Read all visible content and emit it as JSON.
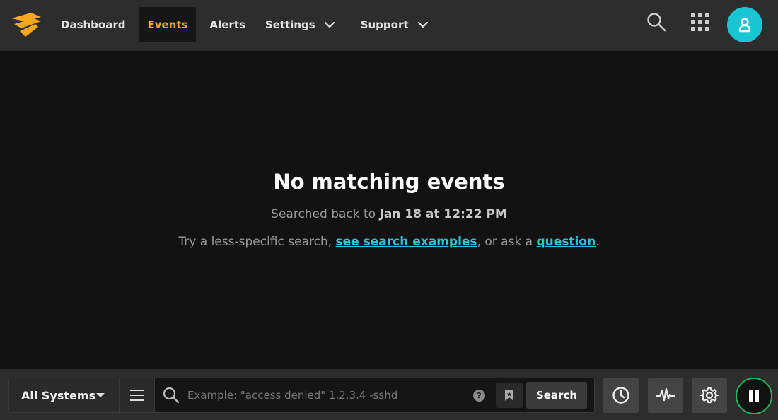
{
  "nav": {
    "items": [
      {
        "label": "Dashboard"
      },
      {
        "label": "Events"
      },
      {
        "label": "Alerts"
      },
      {
        "label": "Settings"
      },
      {
        "label": "Support"
      }
    ],
    "active": "Events"
  },
  "icons": {
    "logo": "papertrail-logo",
    "search": "search-icon",
    "apps": "grid-icon",
    "avatar": "user-icon",
    "menu": "hamburger-icon",
    "help": "question-icon",
    "bookmark": "bookmark-icon",
    "history": "clock-icon",
    "graph": "pulse-icon",
    "settings": "gear-icon",
    "pause": "pause-icon"
  },
  "colors": {
    "accent": "#f5a623",
    "link": "#2ec4d6",
    "avatar": "#17c6d3",
    "live": "#21b25a"
  },
  "empty": {
    "title": "No matching events",
    "searched_prefix": "Searched back to",
    "searched_date": "Jan 18 at 12:22 PM",
    "hint_prefix": "Try a less-specific search,",
    "hint_link1": "see search examples",
    "hint_middle": ", or ask a",
    "hint_link2": "question",
    "hint_suffix": "."
  },
  "search": {
    "systems_label": "All Systems",
    "placeholder": "Example: \"access denied\" 1.2.3.4 -sshd",
    "help_label": "?",
    "button_label": "Search"
  }
}
